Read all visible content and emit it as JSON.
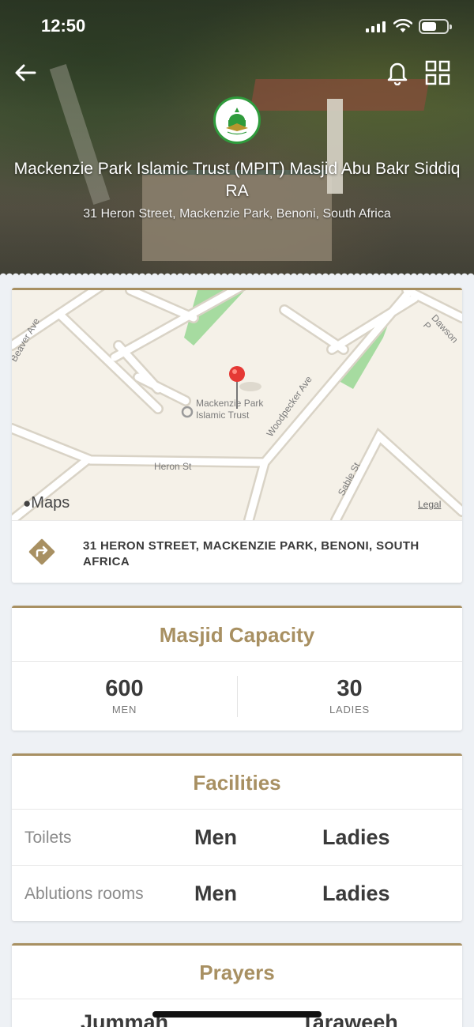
{
  "status_bar": {
    "time": "12:50"
  },
  "header": {
    "title": "Mackenzie Park Islamic Trust (MPIT) Masjid Abu Bakr Siddiq RA",
    "address": "31 Heron Street, Mackenzie Park, Benoni, South Africa"
  },
  "map": {
    "poi_label": "Mackenzie Park Islamic Trust",
    "streets": [
      "Beaver Ave",
      "Woodpecker Ave",
      "Heron St",
      "Sable St",
      "Dawson P"
    ],
    "brand": "Maps",
    "legal": "Legal"
  },
  "address_card": {
    "text": "31 HERON STREET, MACKENZIE PARK, BENONI, SOUTH AFRICA"
  },
  "capacity": {
    "title": "Masjid Capacity",
    "men_value": "600",
    "men_label": "MEN",
    "ladies_value": "30",
    "ladies_label": "LADIES"
  },
  "facilities": {
    "title": "Facilities",
    "rows": [
      {
        "name": "Toilets",
        "men": "Men",
        "ladies": "Ladies"
      },
      {
        "name": "Ablutions rooms",
        "men": "Men",
        "ladies": "Ladies"
      }
    ]
  },
  "prayers": {
    "title": "Prayers",
    "left": "Jummah",
    "right": "Taraweeh"
  },
  "colors": {
    "accent": "#a89062",
    "text": "#3a3a3a",
    "muted": "#8b8b8b",
    "background": "#eef1f5"
  }
}
